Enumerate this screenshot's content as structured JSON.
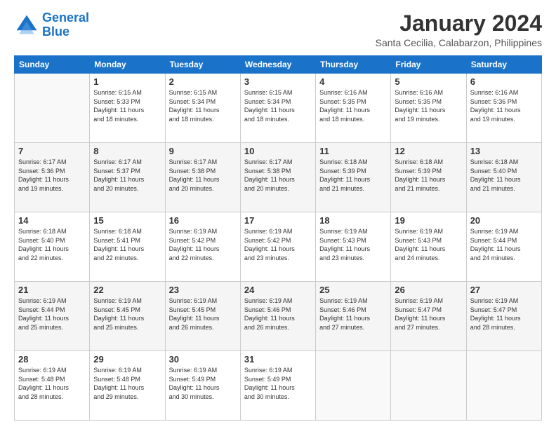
{
  "header": {
    "logo_line1": "General",
    "logo_line2": "Blue",
    "main_title": "January 2024",
    "subtitle": "Santa Cecilia, Calabarzon, Philippines"
  },
  "calendar": {
    "columns": [
      "Sunday",
      "Monday",
      "Tuesday",
      "Wednesday",
      "Thursday",
      "Friday",
      "Saturday"
    ],
    "rows": [
      [
        {
          "day": "",
          "info": ""
        },
        {
          "day": "1",
          "info": "Sunrise: 6:15 AM\nSunset: 5:33 PM\nDaylight: 11 hours\nand 18 minutes."
        },
        {
          "day": "2",
          "info": "Sunrise: 6:15 AM\nSunset: 5:34 PM\nDaylight: 11 hours\nand 18 minutes."
        },
        {
          "day": "3",
          "info": "Sunrise: 6:15 AM\nSunset: 5:34 PM\nDaylight: 11 hours\nand 18 minutes."
        },
        {
          "day": "4",
          "info": "Sunrise: 6:16 AM\nSunset: 5:35 PM\nDaylight: 11 hours\nand 18 minutes."
        },
        {
          "day": "5",
          "info": "Sunrise: 6:16 AM\nSunset: 5:35 PM\nDaylight: 11 hours\nand 19 minutes."
        },
        {
          "day": "6",
          "info": "Sunrise: 6:16 AM\nSunset: 5:36 PM\nDaylight: 11 hours\nand 19 minutes."
        }
      ],
      [
        {
          "day": "7",
          "info": "Sunrise: 6:17 AM\nSunset: 5:36 PM\nDaylight: 11 hours\nand 19 minutes."
        },
        {
          "day": "8",
          "info": "Sunrise: 6:17 AM\nSunset: 5:37 PM\nDaylight: 11 hours\nand 20 minutes."
        },
        {
          "day": "9",
          "info": "Sunrise: 6:17 AM\nSunset: 5:38 PM\nDaylight: 11 hours\nand 20 minutes."
        },
        {
          "day": "10",
          "info": "Sunrise: 6:17 AM\nSunset: 5:38 PM\nDaylight: 11 hours\nand 20 minutes."
        },
        {
          "day": "11",
          "info": "Sunrise: 6:18 AM\nSunset: 5:39 PM\nDaylight: 11 hours\nand 21 minutes."
        },
        {
          "day": "12",
          "info": "Sunrise: 6:18 AM\nSunset: 5:39 PM\nDaylight: 11 hours\nand 21 minutes."
        },
        {
          "day": "13",
          "info": "Sunrise: 6:18 AM\nSunset: 5:40 PM\nDaylight: 11 hours\nand 21 minutes."
        }
      ],
      [
        {
          "day": "14",
          "info": "Sunrise: 6:18 AM\nSunset: 5:40 PM\nDaylight: 11 hours\nand 22 minutes."
        },
        {
          "day": "15",
          "info": "Sunrise: 6:18 AM\nSunset: 5:41 PM\nDaylight: 11 hours\nand 22 minutes."
        },
        {
          "day": "16",
          "info": "Sunrise: 6:19 AM\nSunset: 5:42 PM\nDaylight: 11 hours\nand 22 minutes."
        },
        {
          "day": "17",
          "info": "Sunrise: 6:19 AM\nSunset: 5:42 PM\nDaylight: 11 hours\nand 23 minutes."
        },
        {
          "day": "18",
          "info": "Sunrise: 6:19 AM\nSunset: 5:43 PM\nDaylight: 11 hours\nand 23 minutes."
        },
        {
          "day": "19",
          "info": "Sunrise: 6:19 AM\nSunset: 5:43 PM\nDaylight: 11 hours\nand 24 minutes."
        },
        {
          "day": "20",
          "info": "Sunrise: 6:19 AM\nSunset: 5:44 PM\nDaylight: 11 hours\nand 24 minutes."
        }
      ],
      [
        {
          "day": "21",
          "info": "Sunrise: 6:19 AM\nSunset: 5:44 PM\nDaylight: 11 hours\nand 25 minutes."
        },
        {
          "day": "22",
          "info": "Sunrise: 6:19 AM\nSunset: 5:45 PM\nDaylight: 11 hours\nand 25 minutes."
        },
        {
          "day": "23",
          "info": "Sunrise: 6:19 AM\nSunset: 5:45 PM\nDaylight: 11 hours\nand 26 minutes."
        },
        {
          "day": "24",
          "info": "Sunrise: 6:19 AM\nSunset: 5:46 PM\nDaylight: 11 hours\nand 26 minutes."
        },
        {
          "day": "25",
          "info": "Sunrise: 6:19 AM\nSunset: 5:46 PM\nDaylight: 11 hours\nand 27 minutes."
        },
        {
          "day": "26",
          "info": "Sunrise: 6:19 AM\nSunset: 5:47 PM\nDaylight: 11 hours\nand 27 minutes."
        },
        {
          "day": "27",
          "info": "Sunrise: 6:19 AM\nSunset: 5:47 PM\nDaylight: 11 hours\nand 28 minutes."
        }
      ],
      [
        {
          "day": "28",
          "info": "Sunrise: 6:19 AM\nSunset: 5:48 PM\nDaylight: 11 hours\nand 28 minutes."
        },
        {
          "day": "29",
          "info": "Sunrise: 6:19 AM\nSunset: 5:48 PM\nDaylight: 11 hours\nand 29 minutes."
        },
        {
          "day": "30",
          "info": "Sunrise: 6:19 AM\nSunset: 5:49 PM\nDaylight: 11 hours\nand 30 minutes."
        },
        {
          "day": "31",
          "info": "Sunrise: 6:19 AM\nSunset: 5:49 PM\nDaylight: 11 hours\nand 30 minutes."
        },
        {
          "day": "",
          "info": ""
        },
        {
          "day": "",
          "info": ""
        },
        {
          "day": "",
          "info": ""
        }
      ]
    ]
  }
}
